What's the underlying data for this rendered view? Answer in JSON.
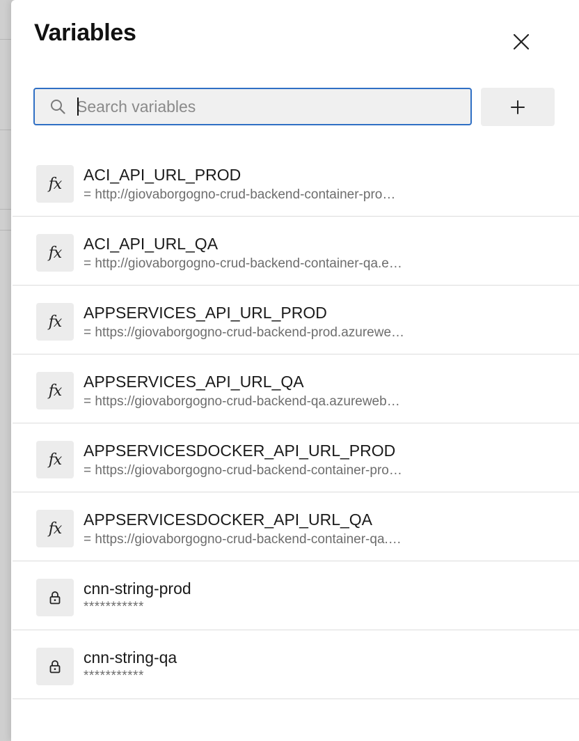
{
  "panel": {
    "title": "Variables",
    "search": {
      "placeholder": "Search variables",
      "value": ""
    },
    "add_button_icon": "plus-icon",
    "close_button_icon": "close-icon"
  },
  "variables": [
    {
      "name": "ACI_API_URL_PROD",
      "value": "= http://giovaborgogno-crud-backend-container-pro…",
      "icon": "fx-icon"
    },
    {
      "name": "ACI_API_URL_QA",
      "value": "= http://giovaborgogno-crud-backend-container-qa.e…",
      "icon": "fx-icon"
    },
    {
      "name": "APPSERVICES_API_URL_PROD",
      "value": "= https://giovaborgogno-crud-backend-prod.azurewe…",
      "icon": "fx-icon"
    },
    {
      "name": "APPSERVICES_API_URL_QA",
      "value": "= https://giovaborgogno-crud-backend-qa.azureweb…",
      "icon": "fx-icon"
    },
    {
      "name": "APPSERVICESDOCKER_API_URL_PROD",
      "value": "= https://giovaborgogno-crud-backend-container-pro…",
      "icon": "fx-icon"
    },
    {
      "name": "APPSERVICESDOCKER_API_URL_QA",
      "value": "= https://giovaborgogno-crud-backend-container-qa.…",
      "icon": "fx-icon"
    },
    {
      "name": "cnn-string-prod",
      "value": "***********",
      "icon": "lock-icon"
    },
    {
      "name": "cnn-string-qa",
      "value": "***********",
      "icon": "lock-icon"
    }
  ],
  "fx_glyph": "fx"
}
